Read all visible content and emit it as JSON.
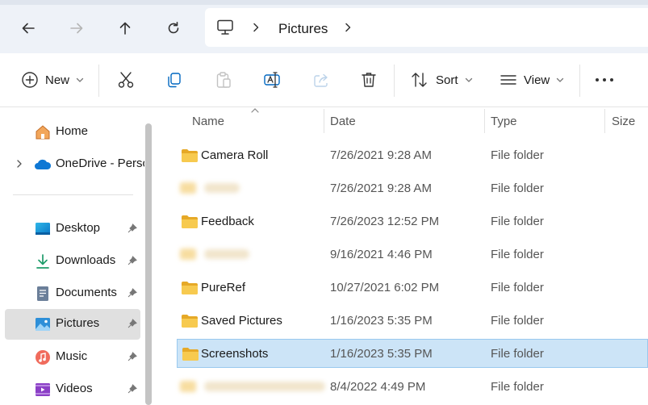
{
  "nav": {
    "back_icon": "arrow-left-icon",
    "forward_icon": "arrow-right-icon",
    "up_icon": "arrow-up-icon",
    "refresh_icon": "refresh-icon"
  },
  "address": {
    "root_icon": "this-pc-icon",
    "current": "Pictures"
  },
  "toolbar": {
    "new_label": "New",
    "sort_label": "Sort",
    "view_label": "View"
  },
  "sidebar": {
    "items": [
      {
        "label": "Home",
        "icon": "home-icon"
      },
      {
        "label": "OneDrive - Personal",
        "icon": "onedrive-cloud-icon"
      },
      {
        "label": "Desktop",
        "icon": "desktop-icon",
        "pinned": true
      },
      {
        "label": "Downloads",
        "icon": "downloads-icon",
        "pinned": true
      },
      {
        "label": "Documents",
        "icon": "documents-icon",
        "pinned": true
      },
      {
        "label": "Pictures",
        "icon": "pictures-icon",
        "pinned": true,
        "selected": true
      },
      {
        "label": "Music",
        "icon": "music-icon",
        "pinned": true
      },
      {
        "label": "Videos",
        "icon": "videos-icon",
        "pinned": true
      }
    ]
  },
  "columns": {
    "name": "Name",
    "date": "Date",
    "type": "Type",
    "size": "Size"
  },
  "files": [
    {
      "name": "Camera Roll",
      "date": "7/26/2021 9:28 AM",
      "type": "File folder"
    },
    {
      "name": "",
      "date": "7/26/2021 9:28 AM",
      "type": "File folder",
      "blurred": true
    },
    {
      "name": "Feedback",
      "date": "7/26/2023 12:52 PM",
      "type": "File folder"
    },
    {
      "name": "",
      "date": "9/16/2021 4:46 PM",
      "type": "File folder",
      "blurred": true
    },
    {
      "name": "PureRef",
      "date": "10/27/2021 6:02 PM",
      "type": "File folder"
    },
    {
      "name": "Saved Pictures",
      "date": "1/16/2023 5:35 PM",
      "type": "File folder"
    },
    {
      "name": "Screenshots",
      "date": "1/16/2023 5:35 PM",
      "type": "File folder",
      "selected": true
    },
    {
      "name": "",
      "date": "8/4/2022 4:49 PM",
      "type": "File folder",
      "blurred": true
    }
  ],
  "colors": {
    "accent": "#0067c0",
    "selection": "#cce4f7",
    "folder": "#f0c24b"
  }
}
